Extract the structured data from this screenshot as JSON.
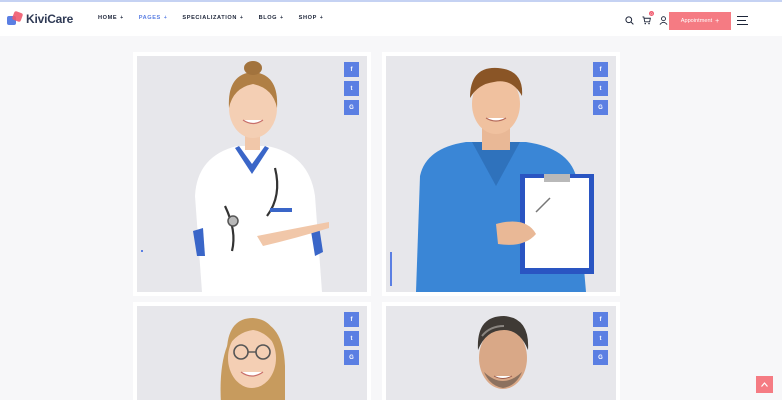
{
  "header": {
    "logo": "KiviCare",
    "nav": [
      {
        "label": "HOME",
        "active": false
      },
      {
        "label": "PAGES",
        "active": true
      },
      {
        "label": "SPECIALIZATION",
        "active": false
      },
      {
        "label": "BLOG",
        "active": false
      },
      {
        "label": "SHOP",
        "active": false
      }
    ],
    "icons": [
      "search-icon",
      "cart-icon",
      "user-icon",
      "menu-icon"
    ],
    "cart_count": "0",
    "appointment_label": "Appointment",
    "appointment_icon": "+"
  },
  "cards": [
    {
      "socials": [
        "f",
        "t",
        "G"
      ],
      "slider_fill": 0.02
    },
    {
      "socials": [
        "f",
        "t",
        "G"
      ],
      "slider_fill": 0.16
    },
    {
      "socials": [
        "f",
        "t",
        "G"
      ]
    },
    {
      "socials": [
        "f",
        "t",
        "G"
      ]
    }
  ],
  "colors": {
    "accent": "#5b7fe3",
    "brand": "#f57b83",
    "photo_bg": "#e7e7eb",
    "page_bg": "#f7f7f9"
  }
}
